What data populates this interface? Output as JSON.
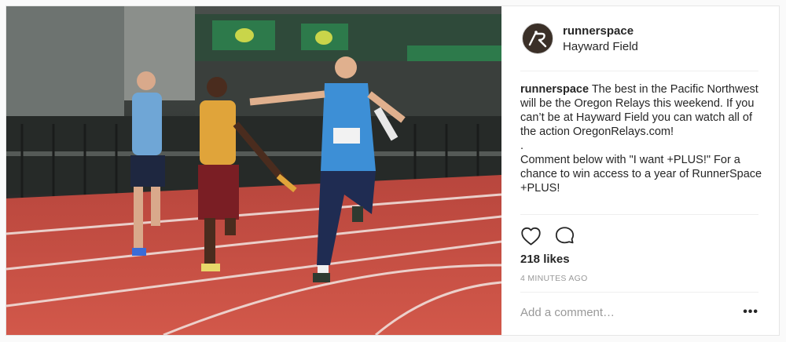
{
  "photo": {
    "alt_subject": "relay race"
  },
  "header": {
    "username": "runnerspace",
    "location": "Hayward Field"
  },
  "caption": {
    "username": "runnerspace",
    "lines": [
      "The best in the Pacific Northwest will be the Oregon Relays this weekend. If you can’t be at Hayward Field you can watch all of the action OregonRelays.com!",
      ".",
      "Comment below with \"I want +PLUS!\" For a chance to win access to a year of RunnerSpace +PLUS!"
    ]
  },
  "actions": {
    "like_icon": "heart-icon",
    "comment_icon": "comment-bubble-icon"
  },
  "likes": "218 likes",
  "timestamp": "4 MINUTES AGO",
  "comment_box": {
    "placeholder": "Add a comment…",
    "more_label": "•••"
  },
  "colors": {
    "track_red": "#c8463a",
    "accent_blue": "#3d8fd6",
    "text": "#262626",
    "muted": "#999999"
  }
}
